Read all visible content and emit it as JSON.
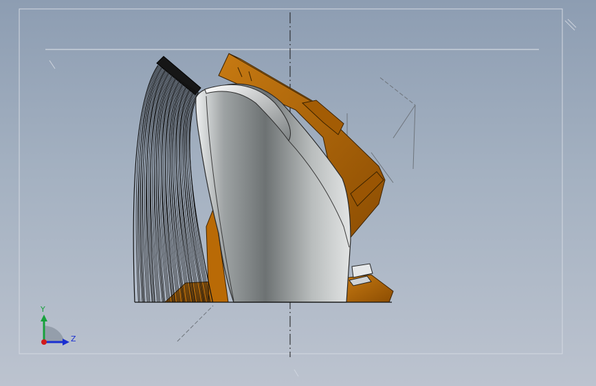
{
  "viewport": {
    "background_top": "#8d9db2",
    "background_bottom": "#bcc3cf",
    "frame_color": "#d9dee6"
  },
  "model": {
    "shell_color": "#a8acac",
    "housing_color": "#b96a06",
    "wire_color": "#111111"
  },
  "triad": {
    "y_label": "Y",
    "z_label": "Z",
    "y_color": "#17a13c",
    "z_color": "#1a2fd1",
    "origin_color": "#d11a1a"
  }
}
